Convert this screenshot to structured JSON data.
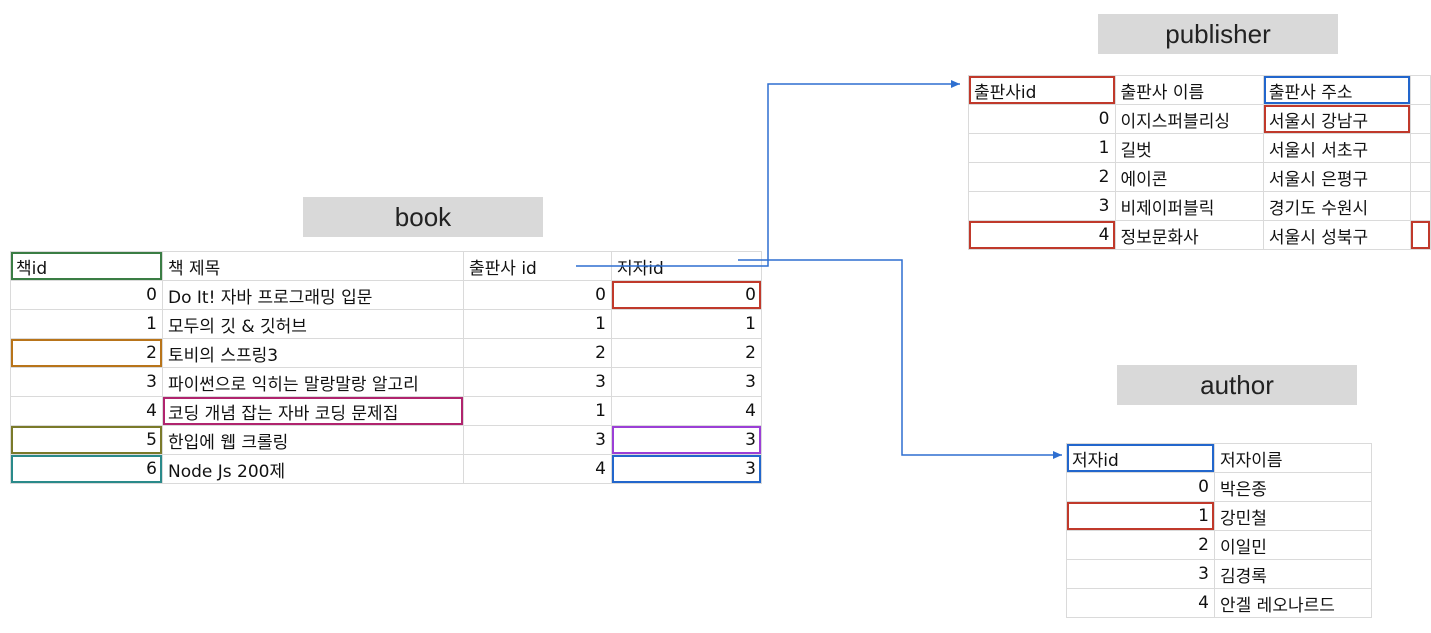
{
  "titles": {
    "book": "book",
    "publisher": "publisher",
    "author": "author"
  },
  "book": {
    "headers": [
      "책id",
      "책 제목",
      "출판사 id",
      "저자id"
    ],
    "rows": [
      [
        "0",
        "Do It! 자바 프로그래밍 입문",
        "0",
        "0"
      ],
      [
        "1",
        "모두의 깃 & 깃허브",
        "1",
        "1"
      ],
      [
        "2",
        "토비의 스프링3",
        "2",
        "2"
      ],
      [
        "3",
        "파이썬으로 익히는 말랑말랑 알고리",
        "3",
        "3"
      ],
      [
        "4",
        "코딩 개념 잡는 자바 코딩 문제집",
        "1",
        "4"
      ],
      [
        "5",
        "한입에 웹 크롤링",
        "3",
        "3"
      ],
      [
        "6",
        "Node Js 200제",
        "4",
        "3"
      ]
    ]
  },
  "publisher": {
    "headers": [
      "출판사id",
      "출판사 이름",
      "출판사 주소"
    ],
    "rows": [
      [
        "0",
        "이지스퍼블리싱",
        "서울시 강남구"
      ],
      [
        "1",
        "길벗",
        "서울시 서초구"
      ],
      [
        "2",
        "에이콘",
        "서울시 은평구"
      ],
      [
        "3",
        "비제이퍼블릭",
        "경기도 수원시"
      ],
      [
        "4",
        "정보문화사",
        "서울시 성북구"
      ]
    ]
  },
  "author": {
    "headers": [
      "저자id",
      "저자이름"
    ],
    "rows": [
      [
        "0",
        "박은종"
      ],
      [
        "1",
        "강민철"
      ],
      [
        "2",
        "이일민"
      ],
      [
        "3",
        "김경록"
      ],
      [
        "4",
        "안겔 레오나르드"
      ]
    ]
  },
  "colors": {
    "green": "#3a7d44",
    "red": "#c0392b",
    "orange": "#b8741a",
    "magenta": "#b0246e",
    "olive": "#7a7a2a",
    "purple": "#9b3fd6",
    "blue": "#2266cc",
    "teal": "#2a8a8a",
    "arrow": "#2e6fd0"
  }
}
